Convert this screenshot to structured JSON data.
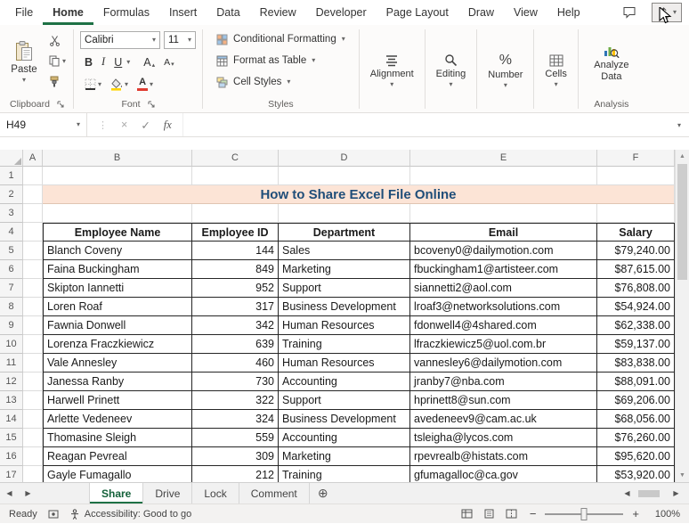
{
  "ribbon_tabs": [
    "File",
    "Home",
    "Formulas",
    "Insert",
    "Data",
    "Review",
    "Developer",
    "Page Layout",
    "Draw",
    "View",
    "Help"
  ],
  "active_tab": "Home",
  "ribbon": {
    "paste_label": "Paste",
    "font_name": "Calibri",
    "font_size": "11",
    "styles_items": [
      "Conditional Formatting",
      "Format as Table",
      "Cell Styles"
    ],
    "collapsed_groups": [
      "Alignment",
      "Editing",
      "Number",
      "Cells"
    ],
    "analyze_button": "Analyze Data",
    "group_labels": {
      "clipboard": "Clipboard",
      "font": "Font",
      "styles": "Styles",
      "analysis": "Analysis"
    }
  },
  "formula_bar": {
    "name_box": "H49",
    "formula": "",
    "fx": "fx",
    "cancel": "×",
    "enter": "✓"
  },
  "grid": {
    "columns": [
      "A",
      "B",
      "C",
      "D",
      "E",
      "F"
    ],
    "visible_rows": 17,
    "title": {
      "row": 2,
      "text": "How to Share Excel File Online"
    },
    "table": {
      "header_row": 4,
      "first_data_row": 5,
      "headers": [
        "Employee Name",
        "Employee ID",
        "Department",
        "Email",
        "Salary"
      ],
      "rows": [
        [
          "Blanch Coveny",
          "144",
          "Sales",
          "bcoveny0@dailymotion.com",
          "$79,240.00"
        ],
        [
          "Faina Buckingham",
          "849",
          "Marketing",
          "fbuckingham1@artisteer.com",
          "$87,615.00"
        ],
        [
          "Skipton Iannetti",
          "952",
          "Support",
          "siannetti2@aol.com",
          "$76,808.00"
        ],
        [
          "Loren Roaf",
          "317",
          "Business Development",
          "lroaf3@networksolutions.com",
          "$54,924.00"
        ],
        [
          "Fawnia Donwell",
          "342",
          "Human Resources",
          "fdonwell4@4shared.com",
          "$62,338.00"
        ],
        [
          "Lorenza Fraczkiewicz",
          "639",
          "Training",
          "lfraczkiewicz5@uol.com.br",
          "$59,137.00"
        ],
        [
          "Vale Annesley",
          "460",
          "Human Resources",
          "vannesley6@dailymotion.com",
          "$83,838.00"
        ],
        [
          "Janessa Ranby",
          "730",
          "Accounting",
          "jranby7@nba.com",
          "$88,091.00"
        ],
        [
          "Harwell Prinett",
          "322",
          "Support",
          "hprinett8@sun.com",
          "$69,206.00"
        ],
        [
          "Arlette Vedeneev",
          "324",
          "Business Development",
          "avedeneev9@cam.ac.uk",
          "$68,056.00"
        ],
        [
          "Thomasine Sleigh",
          "559",
          "Accounting",
          "tsleigha@lycos.com",
          "$76,260.00"
        ],
        [
          "Reagan Pevreal",
          "309",
          "Marketing",
          "rpevrealb@histats.com",
          "$95,620.00"
        ],
        [
          "Gayle Fumagallo",
          "212",
          "Training",
          "gfumagalloc@ca.gov",
          "$53,920.00"
        ]
      ]
    }
  },
  "sheet_tabs": {
    "tabs": [
      "Share",
      "Drive",
      "Lock",
      "Comment"
    ],
    "active": "Share",
    "new_sheet": "⊕"
  },
  "status_bar": {
    "mode": "Ready",
    "accessibility": "Accessibility: Good to go",
    "zoom": "100%"
  },
  "colors": {
    "accent": "#1e7145",
    "title_bg": "#FCE4D6",
    "title_text": "#1F4E79",
    "table_border": "#262626"
  }
}
